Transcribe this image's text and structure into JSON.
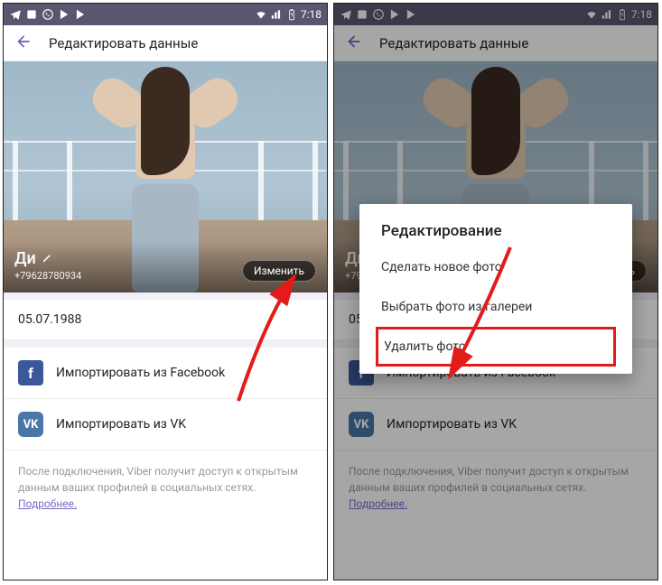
{
  "statusbar": {
    "time": "7:18"
  },
  "appbar": {
    "title": "Редактировать данные"
  },
  "profile": {
    "name": "Ди",
    "phone": "+79628780934",
    "change_label": "Изменить",
    "birthdate": "05.07.1988"
  },
  "imports": {
    "facebook": "Импортировать из Facebook",
    "vk": "Импортировать из VK"
  },
  "footer": {
    "text": "После подключения, Viber получит доступ к открытым данным ваших профилей в социальных сетях.",
    "link": "Подробнее."
  },
  "dialog": {
    "title": "Редактирование",
    "option_new": "Сделать новое фото",
    "option_gallery": "Выбрать фото из галереи",
    "option_delete": "Удалить фото"
  }
}
